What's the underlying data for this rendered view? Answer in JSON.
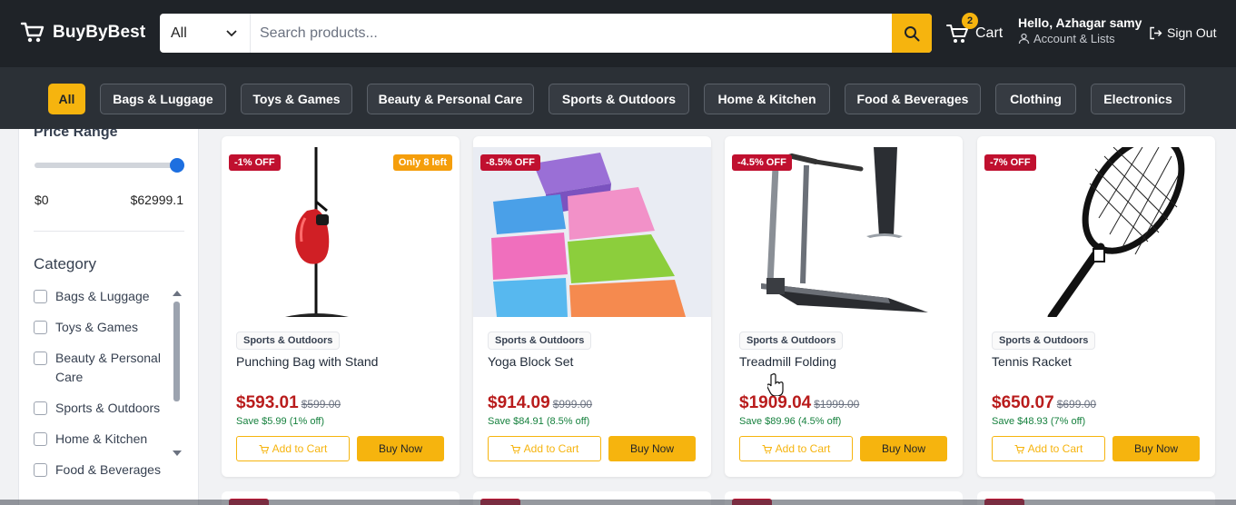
{
  "header": {
    "brand": "BuyByBest",
    "search": {
      "category": "All",
      "placeholder": "Search products..."
    },
    "cart": {
      "count": "2",
      "label": "Cart"
    },
    "account": {
      "greeting": "Hello, Azhagar samy",
      "sub_label": "Account & Lists"
    },
    "sign_out": "Sign Out"
  },
  "categories": [
    "All",
    "Bags & Luggage",
    "Toys & Games",
    "Beauty & Personal Care",
    "Sports & Outdoors",
    "Home & Kitchen",
    "Food & Beverages",
    "Clothing",
    "Electronics"
  ],
  "sidebar": {
    "price_title": "Price Range",
    "price_min": "$0",
    "price_max": "$62999.1",
    "price_slider_fraction": 1.0,
    "category_title": "Category",
    "category_items": [
      "Bags & Luggage",
      "Toys & Games",
      "Beauty & Personal Care",
      "Sports & Outdoors",
      "Home & Kitchen",
      "Food & Beverages"
    ]
  },
  "products": [
    {
      "discount": "-1% OFF",
      "stock": "Only 8 left",
      "category": "Sports & Outdoors",
      "name": "Punching Bag with Stand",
      "price": "$593.01",
      "was": "$599.00",
      "save": "Save $5.99 (1% off)",
      "add": "Add to Cart",
      "buy": "Buy Now"
    },
    {
      "discount": "-8.5% OFF",
      "category": "Sports & Outdoors",
      "name": "Yoga Block Set",
      "price": "$914.09",
      "was": "$999.00",
      "save": "Save $84.91 (8.5% off)",
      "add": "Add to Cart",
      "buy": "Buy Now"
    },
    {
      "discount": "-4.5% OFF",
      "category": "Sports & Outdoors",
      "name": "Treadmill Folding",
      "price": "$1909.04",
      "was": "$1999.00",
      "save": "Save $89.96 (4.5% off)",
      "add": "Add to Cart",
      "buy": "Buy Now"
    },
    {
      "discount": "-7% OFF",
      "category": "Sports & Outdoors",
      "name": "Tennis Racket",
      "price": "$650.07",
      "was": "$699.00",
      "save": "Save $48.93 (7% off)",
      "add": "Add to Cart",
      "buy": "Buy Now"
    }
  ],
  "colors": {
    "header_bg": "#1f2328",
    "catbar_bg": "#2b3036",
    "accent": "#f6b40e",
    "discount_badge": "#c0102f",
    "price": "#b91c1c",
    "save": "#15803d"
  }
}
